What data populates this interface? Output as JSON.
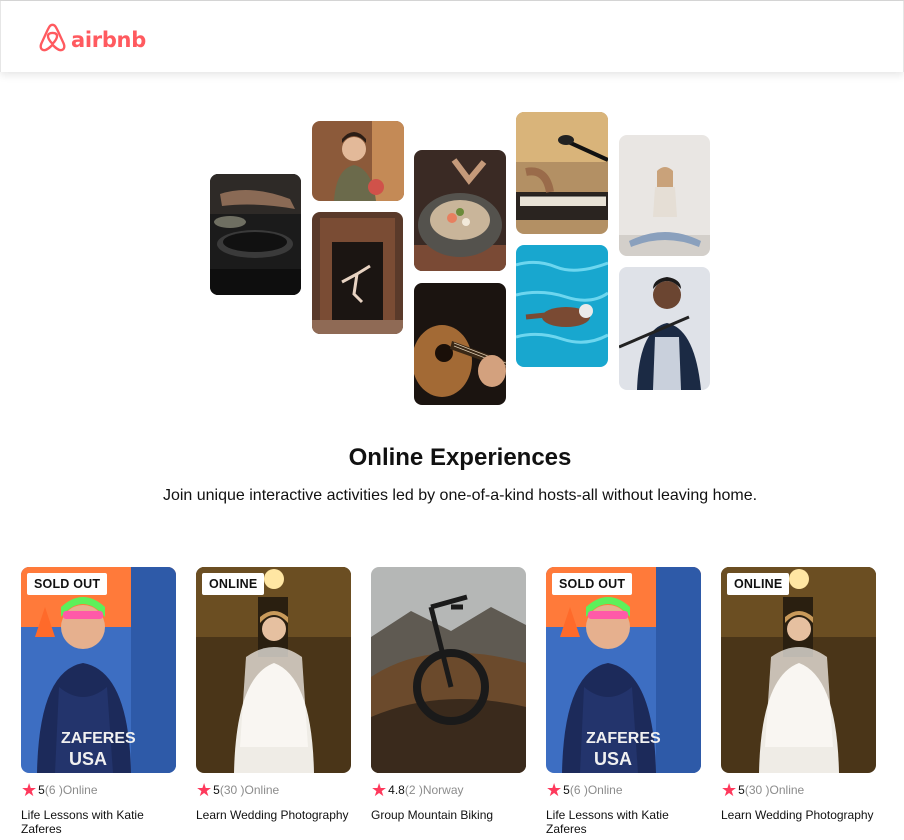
{
  "brand": {
    "name": "airbnb",
    "color": "#ff5a5f"
  },
  "hero": {
    "title": "Online Experiences",
    "subtitle": "Join unique interactive activities led by one-of-a-kind hosts-all without leaving home."
  },
  "photos": [
    {
      "name": "photo-cooking-pans"
    },
    {
      "name": "photo-cooking-host"
    },
    {
      "name": "photo-dancer-doorway"
    },
    {
      "name": "photo-food-bowl"
    },
    {
      "name": "photo-guitar"
    },
    {
      "name": "photo-piano-microphone"
    },
    {
      "name": "photo-swimmer"
    },
    {
      "name": "photo-yoga"
    },
    {
      "name": "photo-singer"
    }
  ],
  "cards": [
    {
      "badge": "SOLD OUT",
      "rating": "5",
      "count": "(6 )",
      "location": "Online",
      "title": "Life Lessons with Katie Zaferes"
    },
    {
      "badge": "ONLINE",
      "rating": "5",
      "count": "(30 )",
      "location": "Online",
      "title": "Learn Wedding Photography"
    },
    {
      "badge": "",
      "rating": "4.8",
      "count": "(2 )",
      "location": "Norway",
      "title": "Group Mountain Biking"
    },
    {
      "badge": "SOLD OUT",
      "rating": "5",
      "count": "(6 )",
      "location": "Online",
      "title": "Life Lessons with Katie Zaferes"
    },
    {
      "badge": "ONLINE",
      "rating": "5",
      "count": "(30 )",
      "location": "Online",
      "title": "Learn Wedding Photography"
    }
  ],
  "icons": {
    "star": "star-icon",
    "logo": "airbnb-logo-icon"
  },
  "colors": {
    "star": "#fe395c",
    "muted_text": "#8c8c8c"
  }
}
